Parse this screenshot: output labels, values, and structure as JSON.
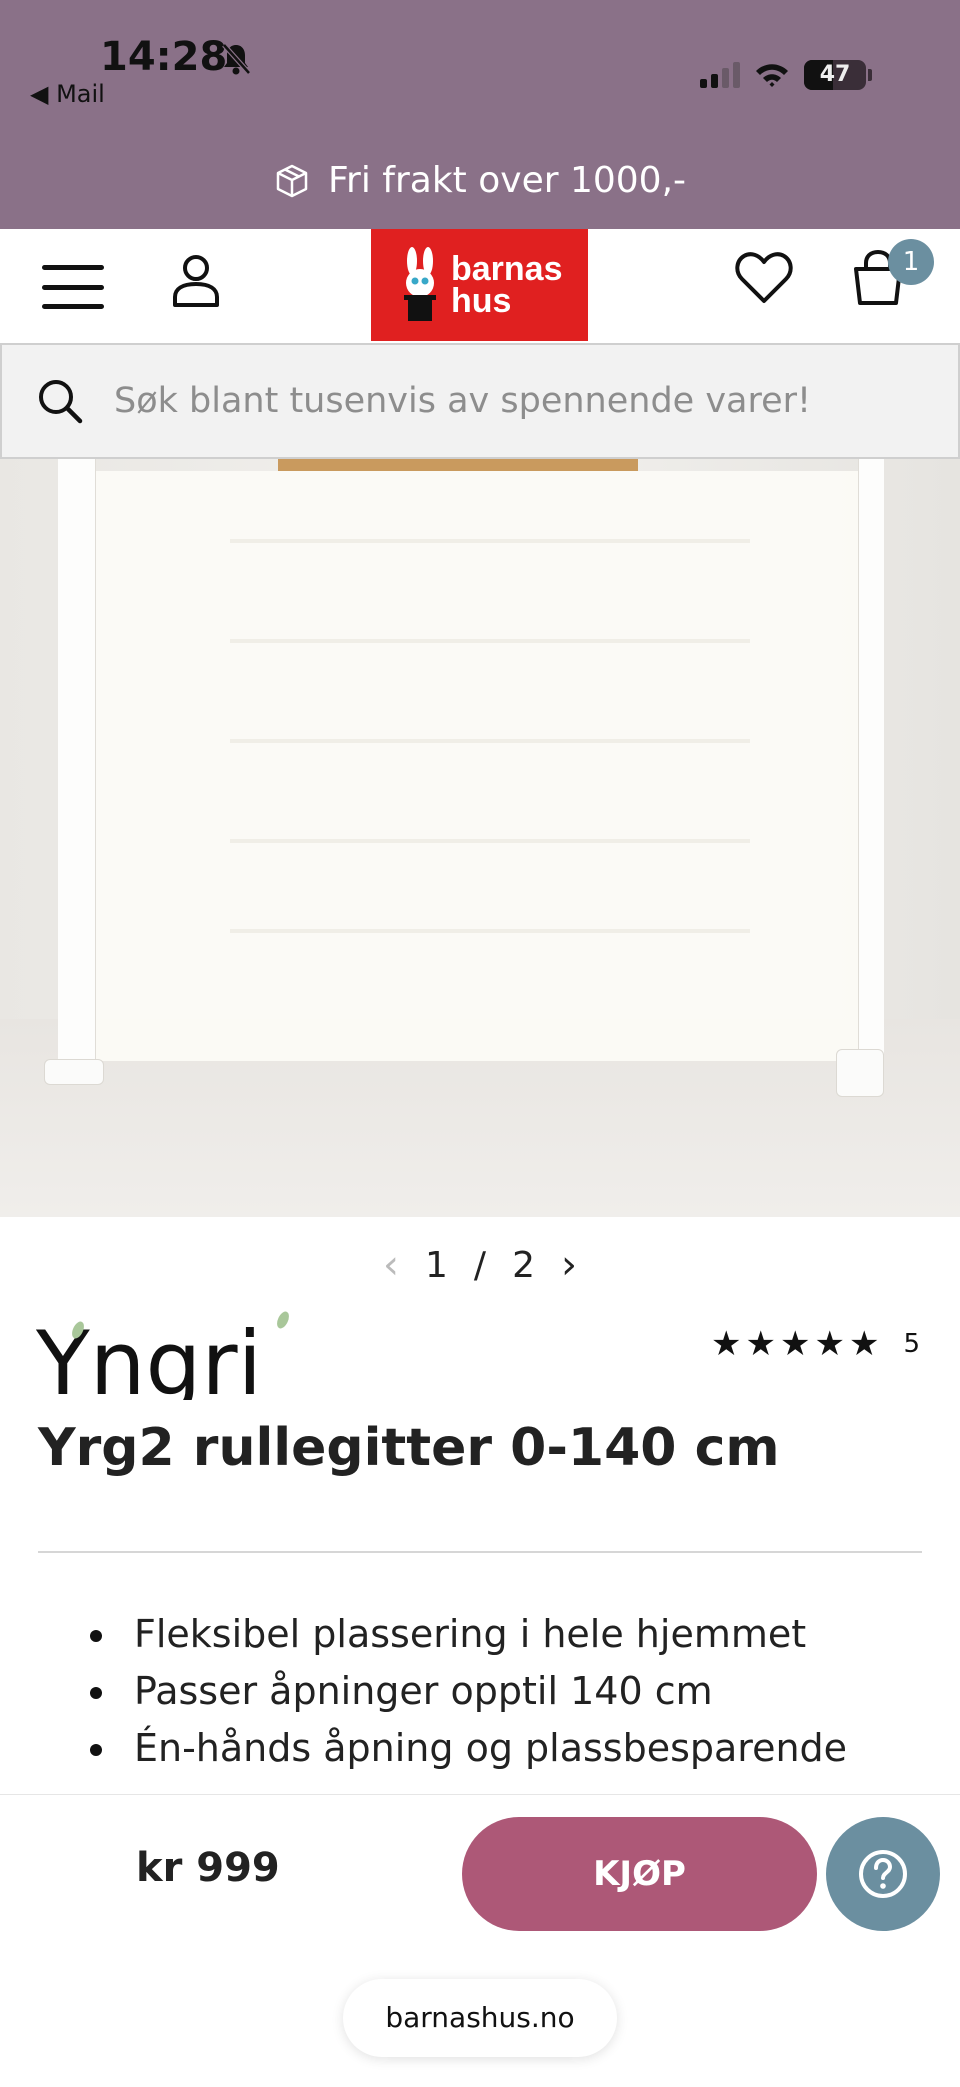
{
  "status_bar": {
    "time": "14:28",
    "back_label": "Mail",
    "battery": "47",
    "battery_level": 0.47
  },
  "promo": {
    "text": "Fri frakt over 1000,-"
  },
  "header": {
    "logo_line1": "barnas",
    "logo_line2": "hus",
    "cart_count": "1"
  },
  "search": {
    "placeholder": "Søk blant tusenvis av spennende varer!"
  },
  "gallery": {
    "current": "1",
    "separator": "/",
    "total": "2"
  },
  "product": {
    "brand": "Yngri",
    "rating_stars": 5,
    "rating_count": "5",
    "title": "Yrg2 rullegitter 0-140 cm",
    "features": [
      "Fleksibel plassering i hele hjemmet",
      "Passer åpninger opptil 140 cm",
      "Én-hånds åpning og plassbesparende"
    ]
  },
  "purchase": {
    "price": "kr 999",
    "buy_label": "KJØP"
  },
  "browser": {
    "url": "barnashus.no"
  },
  "colors": {
    "top_band": "#8a7188",
    "logo_red": "#e02020",
    "buy_button": "#ad5877",
    "accent_blue": "#6b8fa0"
  },
  "icons": [
    "bell-slash-icon",
    "signal-icon",
    "wifi-icon",
    "battery-icon",
    "package-icon",
    "menu-icon",
    "user-icon",
    "heart-icon",
    "cart-icon",
    "search-icon",
    "chevron-left-icon",
    "chevron-right-icon",
    "star-icon",
    "help-icon"
  ]
}
